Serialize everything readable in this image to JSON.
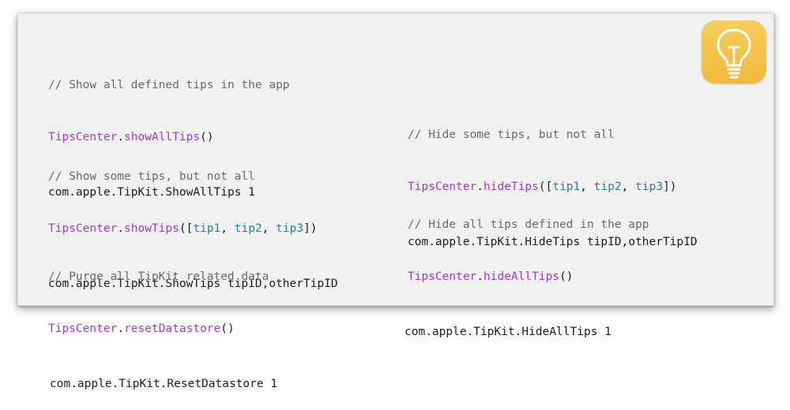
{
  "blocks": [
    {
      "comment": "// Show all defined tips in the app",
      "type": "TipsCenter",
      "dot": ".",
      "method": "showAllTips",
      "args_open": "()",
      "args": [],
      "args_close": "",
      "command": "com.apple.TipKit.ShowAllTips 1"
    },
    {
      "comment": "// Show some tips, but not all",
      "type": "TipsCenter",
      "dot": ".",
      "method": "showTips",
      "args_open": "([",
      "args": [
        "tip1",
        "tip2",
        "tip3"
      ],
      "args_close": "])",
      "command": "com.apple.TipKit.ShowTips tipID,otherTipID"
    },
    {
      "comment": "// Purge all TipKit related data",
      "type": "TipsCenter",
      "dot": ".",
      "method": "resetDatastore",
      "args_open": "()",
      "args": [],
      "args_close": "",
      "command": "com.apple.TipKit.ResetDatastore 1"
    },
    {
      "comment": "// Hide some tips, but not all",
      "type": "TipsCenter",
      "dot": ".",
      "method": "hideTips",
      "args_open": "([",
      "args": [
        "tip1",
        "tip2",
        "tip3"
      ],
      "args_close": "])",
      "command": "com.apple.TipKit.HideTips tipID,otherTipID"
    },
    {
      "comment": "// Hide all tips defined in the app",
      "type": "TipsCenter",
      "dot": ".",
      "method": "hideAllTips",
      "args_open": "()",
      "args": [],
      "args_close": "",
      "command": "com.apple.TipKit.HideAllTips 1"
    }
  ],
  "arg_separator": ", ",
  "icon": {
    "name": "lightbulb-icon",
    "colors": {
      "background": "#f2c14a",
      "glyph": "#ffffff"
    }
  },
  "colors": {
    "comment": "#6a6a6e",
    "type": "#a03bc9",
    "argument": "#2a7fa0",
    "text": "#1d1d1f",
    "card": "#f1f1f2"
  }
}
